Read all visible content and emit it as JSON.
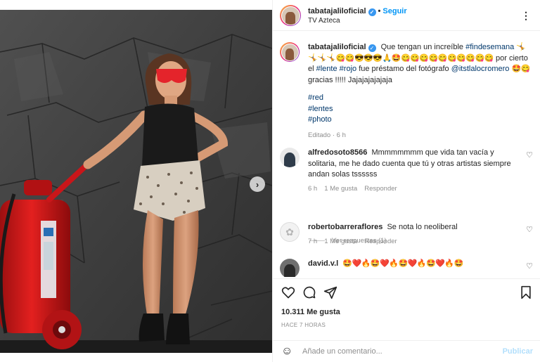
{
  "header": {
    "username": "tabatajaliloficial",
    "follow_label": "Seguir",
    "subtitle": "TV Azteca",
    "separator": "•",
    "more_icon": "more-horizontal-icon"
  },
  "caption": {
    "username": "tabatajaliloficial",
    "text_1": "Que tengan un increíble",
    "tag_1": "#findesemana",
    "emojis_1": "🤸🤸🤸🤸😋😋😎😎😎🙏🤩😋😋😋😋😋😋😋😋😋😋",
    "text_2": "por cierto el",
    "tag_2": "#lente",
    "tag_3": "#rojo",
    "text_3": "fue préstamo del fotógrafo",
    "mention": "@itstlalocromero",
    "emojis_2": "🤩😋",
    "text_4": "gracias !!!!! Jajajajajajaja",
    "tags": [
      "#red",
      "#lentes",
      "#photo"
    ],
    "edited": "Editado · 6 h"
  },
  "comments": [
    {
      "username": "alfredosoto8566",
      "text": "Mmmmmmmm que vida tan vacía y solitaria, me he dado cuenta que tú y otras artistas siempre andan solas tssssss",
      "time": "6 h",
      "likes": "1 Me gusta",
      "reply": "Responder"
    },
    {
      "username": "robertobarreraflores",
      "text": "Se nota lo neoliberal",
      "time": "7 h",
      "likes": "1 Me gusta",
      "reply": "Responder"
    },
    {
      "username": "david.v.l",
      "text": "🤩❤️🔥🤩❤️🔥🤩❤️🔥🤩❤️🔥🤩",
      "time": "",
      "likes": "",
      "reply": ""
    }
  ],
  "view_replies": "Ver respuestas (1)",
  "actions": {
    "likes": "10.311 Me gusta",
    "time_ago": "HACE 7 HORAS"
  },
  "add_comment": {
    "placeholder": "Añade un comentario...",
    "publish": "Publicar"
  },
  "colors": {
    "accent": "#0095f6",
    "verified": "#3897f0",
    "link": "#00376b",
    "muted": "#8e8e8e"
  }
}
